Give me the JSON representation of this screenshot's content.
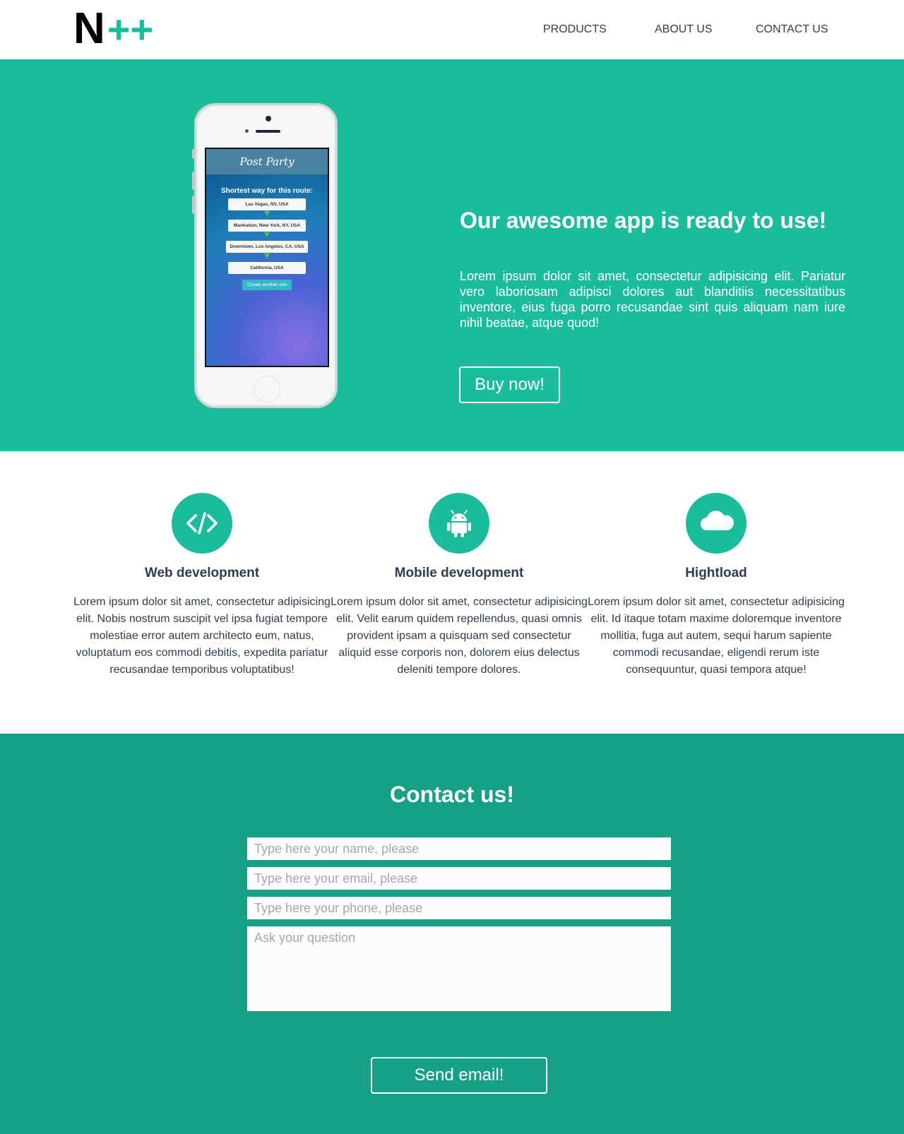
{
  "header": {
    "logo_letter": "N",
    "logo_plus": "++",
    "nav": [
      "PRODUCTS",
      "ABOUT US",
      "CONTACT US"
    ]
  },
  "hero": {
    "title": "Our awesome app is ready to use!",
    "text": "Lorem ipsum dolor sit amet, consectetur adipisicing elit. Pariatur vero laboriosam adipisci dolores aut blanditiis necessitatibus inventore, eius fuga porro recusandae sint quis aliquam nam iure nihil beatae, atque quod!",
    "button": "Buy now!",
    "phone_app": {
      "name": "Post Party",
      "heading": "Shortest way for this route:",
      "routes": [
        "Las Vegas, NV, USA",
        "Manhattan, New York, NY, USA",
        "Downtown, Los Angeles, CA, USA",
        "California, USA"
      ],
      "button": "Create another one"
    }
  },
  "features": [
    {
      "icon": "code-icon",
      "title": "Web development",
      "text": "Lorem ipsum dolor sit amet, consectetur adipisicing elit. Nobis nostrum suscipit vel ipsa fugiat tempore molestiae error autem architecto eum, natus, voluptatum eos commodi debitis, expedita pariatur recusandae temporibus voluptatibus!"
    },
    {
      "icon": "android-icon",
      "title": "Mobile development",
      "text": "Lorem ipsum dolor sit amet, consectetur adipisicing elit. Velit earum quidem repellendus, quasi omnis provident ipsam a quisquam sed consectetur aliquid esse corporis non, dolorem eius delectus deleniti tempore dolores."
    },
    {
      "icon": "cloud-icon",
      "title": "Hightload",
      "text": "Lorem ipsum dolor sit amet, consectetur adipisicing elit. Id itaque totam maxime doloremque inventore mollitia, fuga aut autem, sequi harum sapiente commodi recusandae, eligendi rerum iste consequuntur, quasi tempora atque!"
    }
  ],
  "contact": {
    "title": "Contact us!",
    "name_placeholder": "Type here your name, please",
    "email_placeholder": "Type here your email, please",
    "phone_placeholder": "Type here your phone, please",
    "question_placeholder": "Ask your question",
    "button": "Send email!"
  },
  "colors": {
    "brand": "#1abc9c",
    "contact_bg": "#16a085",
    "text": "#2c3e50"
  }
}
